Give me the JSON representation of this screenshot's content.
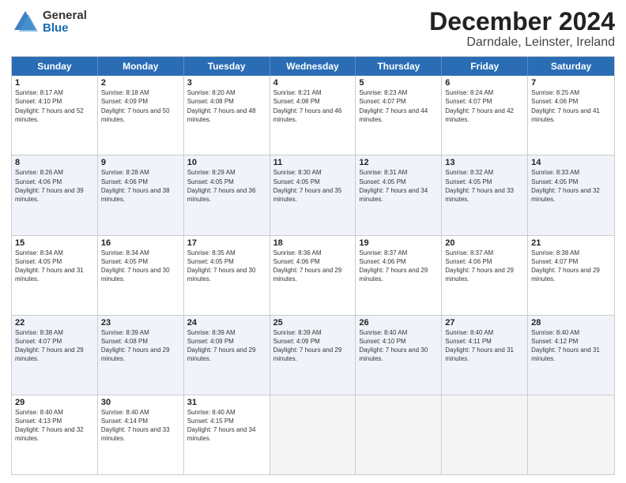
{
  "header": {
    "logo": {
      "general": "General",
      "blue": "Blue"
    },
    "title": "December 2024",
    "location": "Darndale, Leinster, Ireland"
  },
  "calendar": {
    "days": [
      "Sunday",
      "Monday",
      "Tuesday",
      "Wednesday",
      "Thursday",
      "Friday",
      "Saturday"
    ],
    "rows": [
      [
        {
          "day": "1",
          "sunrise": "8:17 AM",
          "sunset": "4:10 PM",
          "daylight": "7 hours and 52 minutes."
        },
        {
          "day": "2",
          "sunrise": "8:18 AM",
          "sunset": "4:09 PM",
          "daylight": "7 hours and 50 minutes."
        },
        {
          "day": "3",
          "sunrise": "8:20 AM",
          "sunset": "4:08 PM",
          "daylight": "7 hours and 48 minutes."
        },
        {
          "day": "4",
          "sunrise": "8:21 AM",
          "sunset": "4:08 PM",
          "daylight": "7 hours and 46 minutes."
        },
        {
          "day": "5",
          "sunrise": "8:23 AM",
          "sunset": "4:07 PM",
          "daylight": "7 hours and 44 minutes."
        },
        {
          "day": "6",
          "sunrise": "8:24 AM",
          "sunset": "4:07 PM",
          "daylight": "7 hours and 42 minutes."
        },
        {
          "day": "7",
          "sunrise": "8:25 AM",
          "sunset": "4:06 PM",
          "daylight": "7 hours and 41 minutes."
        }
      ],
      [
        {
          "day": "8",
          "sunrise": "8:26 AM",
          "sunset": "4:06 PM",
          "daylight": "7 hours and 39 minutes."
        },
        {
          "day": "9",
          "sunrise": "8:28 AM",
          "sunset": "4:06 PM",
          "daylight": "7 hours and 38 minutes."
        },
        {
          "day": "10",
          "sunrise": "8:29 AM",
          "sunset": "4:05 PM",
          "daylight": "7 hours and 36 minutes."
        },
        {
          "day": "11",
          "sunrise": "8:30 AM",
          "sunset": "4:05 PM",
          "daylight": "7 hours and 35 minutes."
        },
        {
          "day": "12",
          "sunrise": "8:31 AM",
          "sunset": "4:05 PM",
          "daylight": "7 hours and 34 minutes."
        },
        {
          "day": "13",
          "sunrise": "8:32 AM",
          "sunset": "4:05 PM",
          "daylight": "7 hours and 33 minutes."
        },
        {
          "day": "14",
          "sunrise": "8:33 AM",
          "sunset": "4:05 PM",
          "daylight": "7 hours and 32 minutes."
        }
      ],
      [
        {
          "day": "15",
          "sunrise": "8:34 AM",
          "sunset": "4:05 PM",
          "daylight": "7 hours and 31 minutes."
        },
        {
          "day": "16",
          "sunrise": "8:34 AM",
          "sunset": "4:05 PM",
          "daylight": "7 hours and 30 minutes."
        },
        {
          "day": "17",
          "sunrise": "8:35 AM",
          "sunset": "4:05 PM",
          "daylight": "7 hours and 30 minutes."
        },
        {
          "day": "18",
          "sunrise": "8:36 AM",
          "sunset": "4:06 PM",
          "daylight": "7 hours and 29 minutes."
        },
        {
          "day": "19",
          "sunrise": "8:37 AM",
          "sunset": "4:06 PM",
          "daylight": "7 hours and 29 minutes."
        },
        {
          "day": "20",
          "sunrise": "8:37 AM",
          "sunset": "4:06 PM",
          "daylight": "7 hours and 29 minutes."
        },
        {
          "day": "21",
          "sunrise": "8:38 AM",
          "sunset": "4:07 PM",
          "daylight": "7 hours and 29 minutes."
        }
      ],
      [
        {
          "day": "22",
          "sunrise": "8:38 AM",
          "sunset": "4:07 PM",
          "daylight": "7 hours and 29 minutes."
        },
        {
          "day": "23",
          "sunrise": "8:39 AM",
          "sunset": "4:08 PM",
          "daylight": "7 hours and 29 minutes."
        },
        {
          "day": "24",
          "sunrise": "8:39 AM",
          "sunset": "4:09 PM",
          "daylight": "7 hours and 29 minutes."
        },
        {
          "day": "25",
          "sunrise": "8:39 AM",
          "sunset": "4:09 PM",
          "daylight": "7 hours and 29 minutes."
        },
        {
          "day": "26",
          "sunrise": "8:40 AM",
          "sunset": "4:10 PM",
          "daylight": "7 hours and 30 minutes."
        },
        {
          "day": "27",
          "sunrise": "8:40 AM",
          "sunset": "4:11 PM",
          "daylight": "7 hours and 31 minutes."
        },
        {
          "day": "28",
          "sunrise": "8:40 AM",
          "sunset": "4:12 PM",
          "daylight": "7 hours and 31 minutes."
        }
      ],
      [
        {
          "day": "29",
          "sunrise": "8:40 AM",
          "sunset": "4:13 PM",
          "daylight": "7 hours and 32 minutes."
        },
        {
          "day": "30",
          "sunrise": "8:40 AM",
          "sunset": "4:14 PM",
          "daylight": "7 hours and 33 minutes."
        },
        {
          "day": "31",
          "sunrise": "8:40 AM",
          "sunset": "4:15 PM",
          "daylight": "7 hours and 34 minutes."
        },
        null,
        null,
        null,
        null
      ]
    ]
  }
}
